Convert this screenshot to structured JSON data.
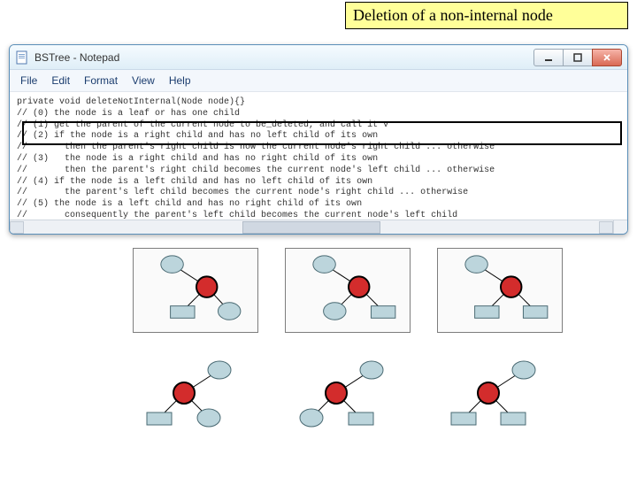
{
  "slide_title": "Deletion of a non-internal node",
  "notepad": {
    "title": "BSTree - Notepad",
    "menu": [
      "File",
      "Edit",
      "Format",
      "View",
      "Help"
    ],
    "code_lines": [
      "private void deleteNotInternal(Node node){}",
      "// (0) the node is a leaf or has one child",
      "// (1) get the parent of the current node to be_deleted, and call it v",
      "// (2) if the node is a right child and has no left child of its own",
      "//       then the parent's right child is now the current node's right child ... otherwise",
      "// (3)   the node is a right child and has no right child of its own",
      "//       then the parent's right child becomes the current node's left child ... otherwise",
      "// (4) if the node is a left child and has no left child of its own",
      "//       the parent's left child becomes the current node's right child ... otherwise",
      "// (5) the node is a left child and has no right child of its own",
      "//       consequently the parent's left child becomes the current node's left child",
      "//"
    ]
  }
}
